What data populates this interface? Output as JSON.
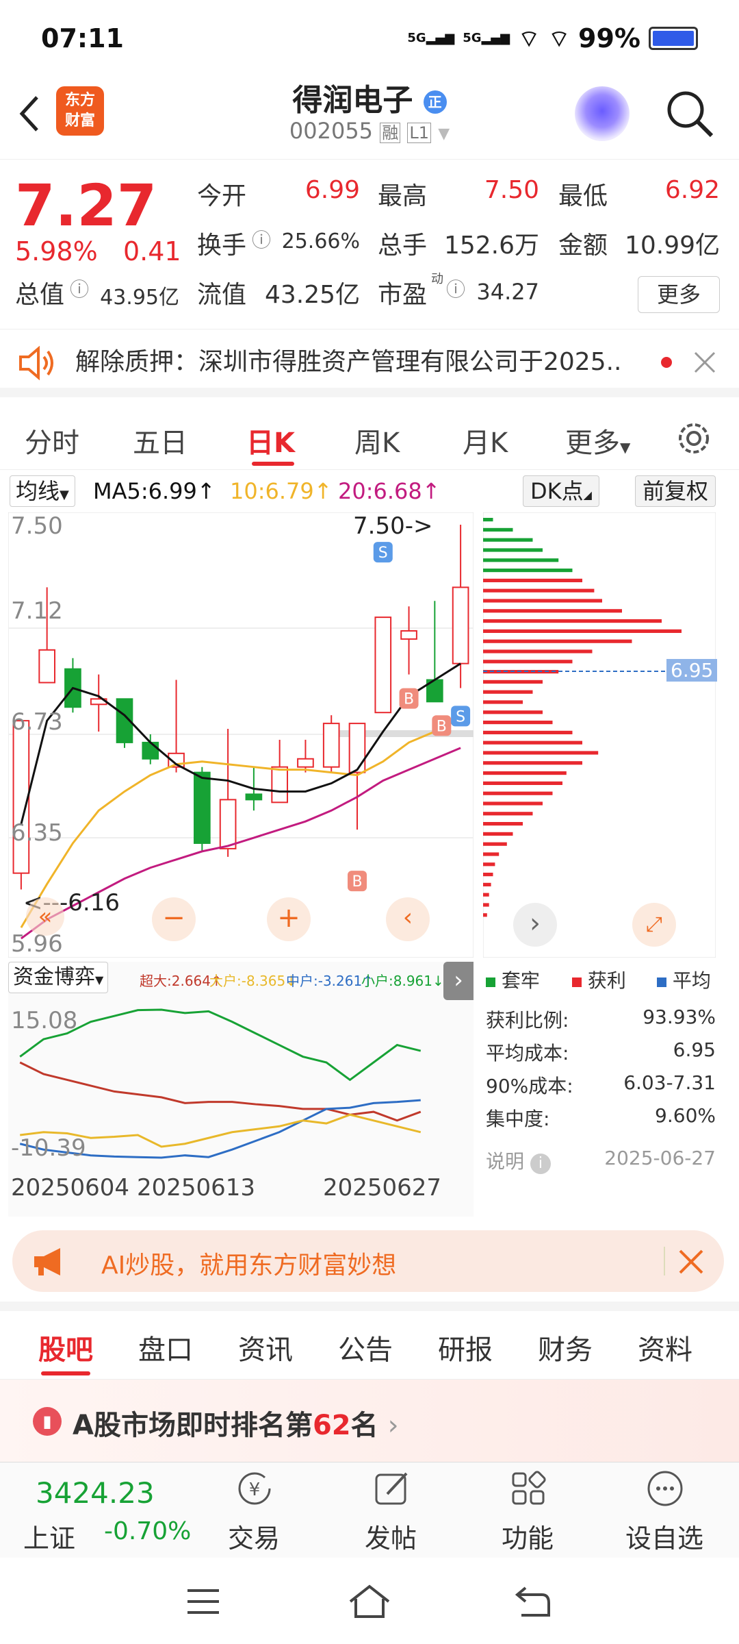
{
  "status_bar": {
    "time": "07:11",
    "signal1": "5G",
    "signal2": "5G",
    "battery": "99%"
  },
  "header": {
    "logo_line1": "东方",
    "logo_line2": "财富",
    "stock_name": "得润电子",
    "badge": "正",
    "code": "002055",
    "tag_rong": "融",
    "tag_level": "L1"
  },
  "quote": {
    "price": "7.27",
    "change_pct": "5.98%",
    "change_amt": "0.41",
    "open_label": "今开",
    "open": "6.99",
    "high_label": "最高",
    "high": "7.50",
    "low_label": "最低",
    "low": "6.92",
    "turnover_label": "换手",
    "turnover": "25.66%",
    "volume_label": "总手",
    "volume": "152.6万",
    "amount_label": "金额",
    "amount": "10.99亿",
    "mktcap_label": "总值",
    "mktcap": "43.95亿",
    "float_label": "流值",
    "float_cap": "43.25亿",
    "pe_label": "市盈",
    "pe_sup": "动",
    "pe": "34.27",
    "more_label": "更多"
  },
  "notice": {
    "text": "解除质押：深圳市得胜资产管理有限公司于2025.."
  },
  "tabs": [
    "分时",
    "五日",
    "日K",
    "周K",
    "月K",
    "更多"
  ],
  "ma": {
    "selector": "均线",
    "ma5": "MA5:6.99",
    "ma10": "10:6.79",
    "ma20": "20:6.68",
    "dk": "DK点",
    "fq": "前复权"
  },
  "kline": {
    "price_labels": [
      "7.50",
      "7.12",
      "6.73",
      "6.35",
      "5.96"
    ],
    "high_marker": "7.50->",
    "low_marker": "<---6.16",
    "cost_badge": "6.95",
    "dist_legend": [
      "套牢",
      "获利",
      "平均"
    ],
    "colors": {
      "up": "#e8282e",
      "down": "#17a235",
      "ma5": "#111111",
      "ma10": "#f0b429",
      "ma20": "#c21b7f"
    },
    "candles": [
      {
        "o": 6.22,
        "c": 6.78,
        "h": 6.78,
        "l": 6.16
      },
      {
        "o": 6.92,
        "c": 7.04,
        "h": 7.27,
        "l": 6.92
      },
      {
        "o": 6.97,
        "c": 6.83,
        "h": 7.01,
        "l": 6.81
      },
      {
        "o": 6.84,
        "c": 6.86,
        "h": 6.95,
        "l": 6.74
      },
      {
        "o": 6.86,
        "c": 6.7,
        "h": 6.86,
        "l": 6.68
      },
      {
        "o": 6.7,
        "c": 6.64,
        "h": 6.73,
        "l": 6.62
      },
      {
        "o": 6.61,
        "c": 6.66,
        "h": 6.93,
        "l": 6.59
      },
      {
        "o": 6.59,
        "c": 6.33,
        "h": 6.61,
        "l": 6.3
      },
      {
        "o": 6.31,
        "c": 6.49,
        "h": 6.75,
        "l": 6.28
      },
      {
        "o": 6.51,
        "c": 6.49,
        "h": 6.61,
        "l": 6.45
      },
      {
        "o": 6.48,
        "c": 6.61,
        "h": 6.71,
        "l": 6.48
      },
      {
        "o": 6.61,
        "c": 6.64,
        "h": 6.71,
        "l": 6.59
      },
      {
        "o": 6.61,
        "c": 6.77,
        "h": 6.8,
        "l": 6.59
      },
      {
        "o": 6.59,
        "c": 6.77,
        "h": 6.77,
        "l": 6.38
      },
      {
        "o": 6.81,
        "c": 7.16,
        "h": 7.16,
        "l": 6.81
      },
      {
        "o": 7.08,
        "c": 7.11,
        "h": 7.2,
        "l": 6.95
      },
      {
        "o": 6.93,
        "c": 6.85,
        "h": 7.22,
        "l": 6.85
      },
      {
        "o": 6.99,
        "c": 7.27,
        "h": 7.5,
        "l": 6.9
      }
    ],
    "ma5": [
      6.4,
      6.78,
      6.9,
      6.87,
      6.8,
      6.7,
      6.62,
      6.57,
      6.56,
      6.53,
      6.52,
      6.52,
      6.55,
      6.6,
      6.74,
      6.87,
      6.93,
      6.99
    ],
    "ma10": [
      6.02,
      6.18,
      6.33,
      6.45,
      6.52,
      6.58,
      6.62,
      6.63,
      6.62,
      6.61,
      6.6,
      6.6,
      6.59,
      6.58,
      6.63,
      6.7,
      6.74,
      6.79
    ],
    "ma20": [
      5.98,
      6.05,
      6.1,
      6.15,
      6.2,
      6.24,
      6.27,
      6.3,
      6.32,
      6.35,
      6.38,
      6.41,
      6.45,
      6.5,
      6.56,
      6.6,
      6.64,
      6.68
    ],
    "signals": [
      {
        "i": 13,
        "t": "B"
      },
      {
        "i": 14,
        "t": "S"
      },
      {
        "i": 15,
        "t": "B"
      },
      {
        "i": 16,
        "t": "B"
      },
      {
        "i": 17,
        "t": "S"
      }
    ],
    "dist_bars": [
      0.05,
      0.15,
      0.25,
      0.3,
      0.38,
      0.45,
      0.5,
      0.56,
      0.6,
      0.7,
      0.9,
      1.0,
      0.75,
      0.55,
      0.45,
      0.38,
      0.3,
      0.25,
      0.2,
      0.3,
      0.35,
      0.45,
      0.5,
      0.58,
      0.5,
      0.42,
      0.4,
      0.35,
      0.3,
      0.25,
      0.2,
      0.15,
      0.12,
      0.08,
      0.06,
      0.05,
      0.04,
      0.03,
      0.03,
      0.02
    ]
  },
  "fund_flow": {
    "selector": "资金博弈",
    "super": "超大:2.664",
    "big": "大户:-8.365",
    "mid": "中户:-3.261",
    "small": "小户:8.961",
    "top": "15.08",
    "bottom": "-10.39",
    "dates": [
      "20250604",
      "20250613",
      "20250627"
    ],
    "colors": {
      "super": "#17a235",
      "big": "#c0392b",
      "mid": "#2d6dc4",
      "small": "#e8b82a"
    },
    "super_series": [
      7,
      10,
      11,
      13,
      14,
      15,
      15.08,
      14.5,
      14.8,
      13,
      11,
      9,
      7,
      6,
      3,
      6,
      9,
      8
    ],
    "big_series": [
      6,
      4,
      3,
      2,
      1,
      0.5,
      0,
      -1,
      -0.8,
      -0.8,
      -1.2,
      -1.5,
      -2,
      -2,
      -3,
      -2.5,
      -4,
      -2.5
    ],
    "mid_series": [
      -8,
      -9,
      -9.5,
      -10,
      -10.2,
      -10.3,
      -10.39,
      -10,
      -10.3,
      -9,
      -7.5,
      -6,
      -4,
      -2,
      -1.8,
      -1,
      -0.8,
      -0.5
    ],
    "small_series": [
      -6.5,
      -6,
      -6.2,
      -7,
      -6.8,
      -6.5,
      -8.5,
      -8,
      -7,
      -6,
      -5.5,
      -5,
      -4,
      -4.5,
      -3,
      -4,
      -5,
      -6
    ]
  },
  "cost": {
    "profit_label": "获利比例:",
    "profit": "93.93%",
    "avg_label": "平均成本:",
    "avg": "6.95",
    "c90_label": "90%成本:",
    "c90": "6.03-7.31",
    "conc_label": "集中度:",
    "conc": "9.60%",
    "note": "说明",
    "date": "2025-06-27"
  },
  "banner": {
    "text": "AI炒股，就用东方财富妙想"
  },
  "bottom_tabs": [
    "股吧",
    "盘口",
    "资讯",
    "公告",
    "研报",
    "财务",
    "资料"
  ],
  "rank": {
    "prefix": "A股市场即时排名第",
    "num": "62",
    "suffix": "名"
  },
  "bottom_nav": {
    "index_value": "3424.23",
    "index_name": "上证",
    "index_change": "-0.70%",
    "trade": "交易",
    "post": "发帖",
    "func": "功能",
    "watch": "设自选"
  }
}
